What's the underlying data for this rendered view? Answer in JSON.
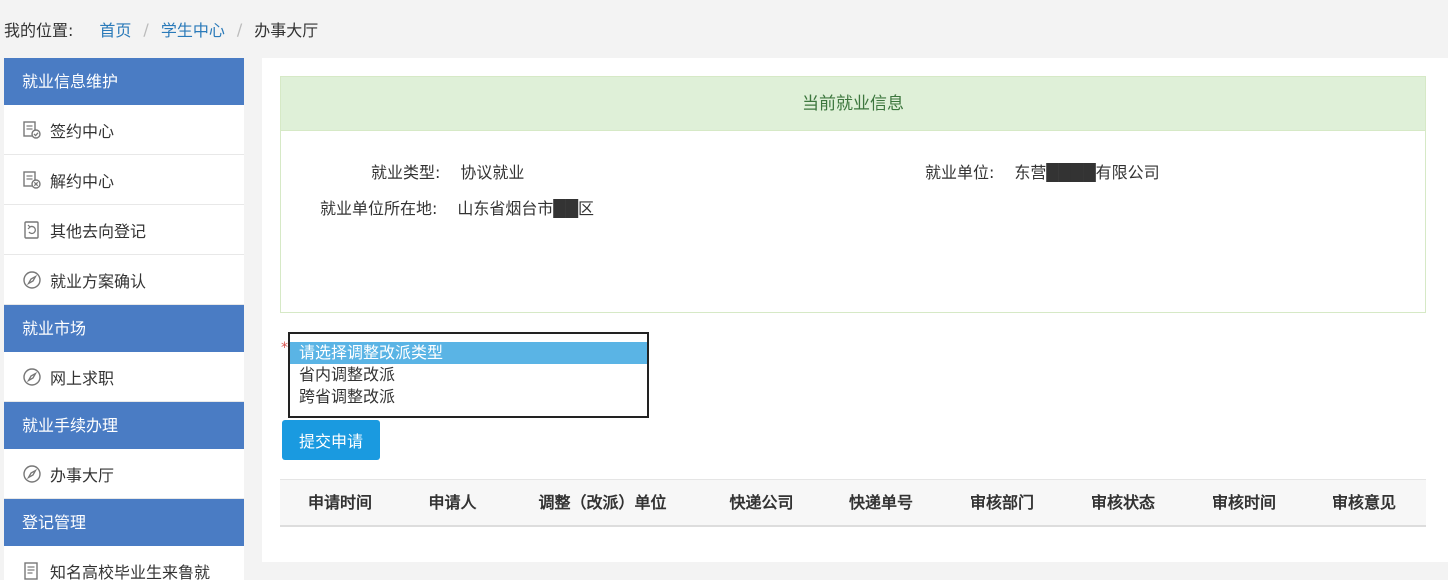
{
  "breadcrumb": {
    "label": "我的位置:",
    "items": [
      "首页",
      "学生中心",
      "办事大厅"
    ],
    "separator": "/"
  },
  "sidebar": {
    "groups": [
      {
        "title": "就业信息维护",
        "items": [
          {
            "label": "签约中心",
            "icon": "doc-check-icon"
          },
          {
            "label": "解约中心",
            "icon": "doc-cancel-icon"
          },
          {
            "label": "其他去向登记",
            "icon": "refresh-doc-icon"
          },
          {
            "label": "就业方案确认",
            "icon": "compass-icon"
          }
        ]
      },
      {
        "title": "就业市场",
        "items": [
          {
            "label": "网上求职",
            "icon": "compass-icon"
          }
        ]
      },
      {
        "title": "就业手续办理",
        "items": [
          {
            "label": "办事大厅",
            "icon": "compass-icon"
          }
        ]
      },
      {
        "title": "登记管理",
        "items": [
          {
            "label": "知名高校毕业生来鲁就",
            "icon": "doc-list-icon"
          }
        ]
      }
    ]
  },
  "info": {
    "title": "当前就业信息",
    "employment_type_label": "就业类型:",
    "employment_type_value": "协议就业",
    "employer_label": "就业单位:",
    "employer_value": "东营████有限公司",
    "location_label": "就业单位所在地:",
    "location_value": "山东省烟台市██区"
  },
  "form": {
    "required_mark": "*",
    "options": [
      "请选择调整改派类型",
      "省内调整改派",
      "跨省调整改派"
    ],
    "selected_index": 0,
    "submit_label": "提交申请"
  },
  "table": {
    "headers": [
      "申请时间",
      "申请人",
      "调整（改派）单位",
      "快递公司",
      "快递单号",
      "审核部门",
      "审核状态",
      "审核时间",
      "审核意见"
    ]
  },
  "colors": {
    "accent": "#4a7cc4",
    "button": "#1a9ae0",
    "panel_header_bg": "#dff0d8",
    "panel_header_text": "#3c763d",
    "link": "#2a7ab9"
  }
}
